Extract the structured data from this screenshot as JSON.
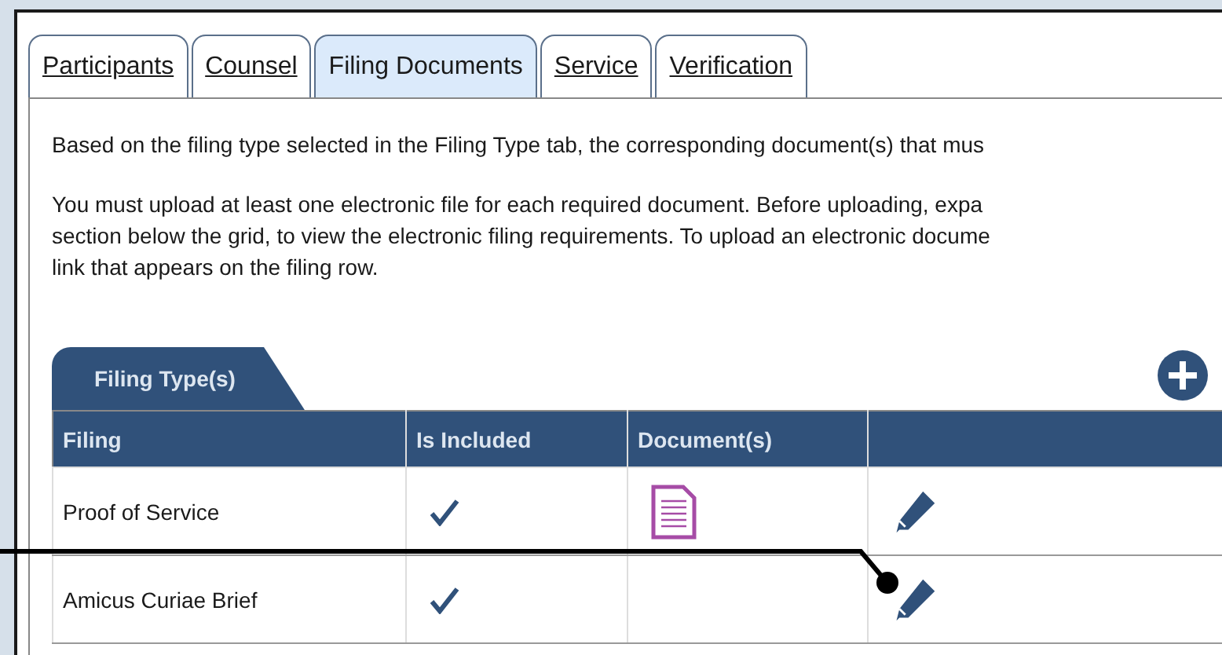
{
  "tabs": [
    {
      "label": "Participants",
      "selected": false
    },
    {
      "label": "Counsel",
      "selected": false
    },
    {
      "label": "Filing Documents",
      "selected": true
    },
    {
      "label": "Service",
      "selected": false
    },
    {
      "label": "Verification",
      "selected": false
    }
  ],
  "paragraphs": [
    [
      "Based on the filing type selected in the Filing Type tab, the corresponding document(s) that mus"
    ],
    [
      "You must upload at least one electronic file for each required document. Before uploading, expa",
      "section below the grid, to view the electronic filing requirements. To upload an electronic docume",
      "link that appears on the filing row."
    ]
  ],
  "grid": {
    "tab_label": "Filing Type(s)",
    "columns": [
      "Filing",
      "Is Included",
      "Document(s)"
    ],
    "rows": [
      {
        "filing": "Proof of Service",
        "included": true,
        "has_document": true
      },
      {
        "filing": "Amicus Curiae Brief",
        "included": true,
        "has_document": false
      }
    ]
  }
}
